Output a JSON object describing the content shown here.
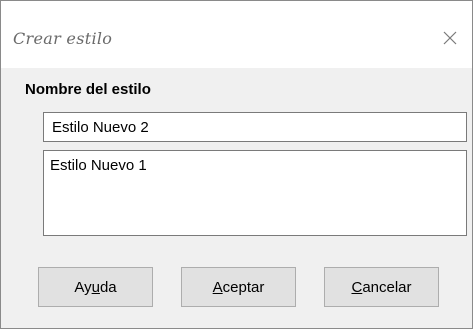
{
  "dialog": {
    "title": "Crear estilo"
  },
  "form": {
    "section_label": "Nombre del estilo",
    "name_value": "Estilo Nuevo 2",
    "styles_list": [
      "Estilo Nuevo 1"
    ]
  },
  "buttons": {
    "help": {
      "pre": "Ay",
      "mnemonic": "u",
      "post": "da"
    },
    "accept": {
      "pre": "",
      "mnemonic": "A",
      "post": "ceptar"
    },
    "cancel": {
      "pre": "",
      "mnemonic": "C",
      "post": "ancelar"
    }
  },
  "icons": {
    "close": "close-icon"
  },
  "colors": {
    "titlebar_bg": "#ffffff",
    "dialog_bg": "#f0f0f0",
    "button_bg": "#e1e1e1",
    "title_text": "#6a6a6a"
  }
}
